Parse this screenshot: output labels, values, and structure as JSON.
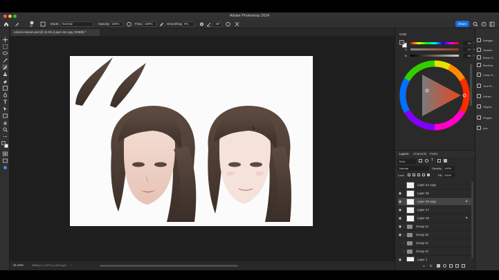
{
  "window": {
    "title": "Adobe Photoshop 2024"
  },
  "options_bar": {
    "brush_size": "20",
    "mode_label": "Mode:",
    "mode_value": "Normal",
    "opacity_label": "Opacity:",
    "opacity_value": "100%",
    "flow_label": "Flow:",
    "flow_value": "100%",
    "smoothing_label": "Smoothing:",
    "smoothing_value": "0%",
    "angle_value": "-45°",
    "share_label": "Share"
  },
  "document": {
    "tab_label": "colorno-texture.psd @ 31.6% (Layer 46 copy, RGB/8) *"
  },
  "status": {
    "zoom": "31.64%",
    "dimensions": "2858 px x 2079 px (300 ppi)"
  },
  "color_panel": {
    "tabs": [
      "Color"
    ],
    "values": [
      "16",
      "13",
      "58"
    ],
    "units": [
      "°",
      "%",
      "%"
    ],
    "labels": [
      "H",
      "S",
      "B"
    ],
    "foreground": "#4a3c34",
    "background": "#ffffff"
  },
  "collapsed_panels": [
    {
      "label": "Navigat...",
      "icon": "compass-icon"
    },
    {
      "label": "Swatch...",
      "icon": "swatches-icon"
    },
    {
      "label": "Brush S...",
      "icon": "brush-settings-icon"
    },
    {
      "label": "Brushes",
      "icon": "brush-icon"
    },
    {
      "label": "Clone S...",
      "icon": "clone-source-icon"
    },
    {
      "label": "Tool Pr...",
      "icon": "tool-presets-icon"
    },
    {
      "label": "Librari...",
      "icon": "libraries-icon"
    },
    {
      "label": "Glyphs",
      "icon": "glyphs-icon"
    },
    {
      "label": "Plugins",
      "icon": "plugins-icon"
    },
    {
      "label": "Info",
      "icon": "info-icon"
    }
  ],
  "layers_panel": {
    "tabs": [
      "Layers",
      "Channels",
      "Paths"
    ],
    "filter_label": "Kind",
    "blend_mode": "Normal",
    "opacity_label": "Opacity:",
    "opacity_value": "100%",
    "lock_label": "Lock:",
    "fill_label": "Fill:",
    "fill_value": "100%",
    "layers": [
      {
        "name": "Layer 41 copy",
        "visible": false,
        "type": "layer",
        "locked": false,
        "selected": false
      },
      {
        "name": "Layer 45",
        "visible": true,
        "type": "layer",
        "locked": false,
        "selected": false
      },
      {
        "name": "Layer 46 copy",
        "visible": true,
        "type": "layer",
        "locked": true,
        "selected": true
      },
      {
        "name": "Layer 47",
        "visible": true,
        "type": "layer",
        "locked": false,
        "selected": false
      },
      {
        "name": "Layer 48",
        "visible": true,
        "type": "layer",
        "locked": true,
        "selected": false
      },
      {
        "name": "Group 14",
        "visible": true,
        "type": "group",
        "locked": false,
        "selected": false
      },
      {
        "name": "Group 15",
        "visible": true,
        "type": "group",
        "locked": false,
        "selected": false
      },
      {
        "name": "Group 12",
        "visible": false,
        "type": "group",
        "locked": false,
        "selected": false
      },
      {
        "name": "Group 13",
        "visible": false,
        "type": "group",
        "locked": false,
        "selected": false
      },
      {
        "name": "Layer 1",
        "visible": true,
        "type": "layer",
        "locked": false,
        "selected": false
      }
    ]
  }
}
